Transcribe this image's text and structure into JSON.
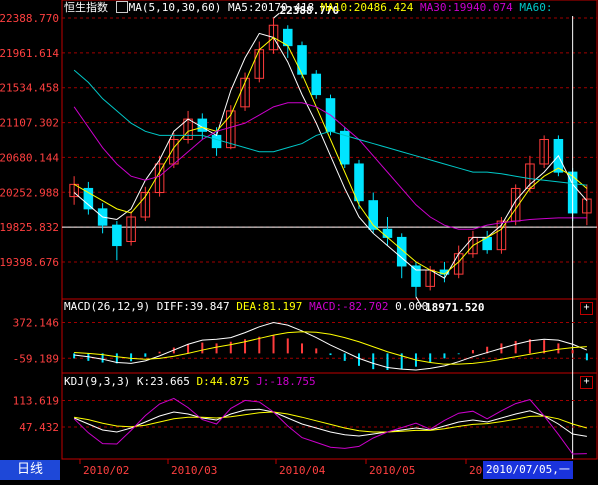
{
  "colors": {
    "up": "#ff3c3c",
    "down": "#00e4ff",
    "ma5": "#ffffff",
    "ma10": "#ffff00",
    "ma30": "#cc00cc",
    "ma60": "#00c8c8",
    "grid": "#a00000",
    "axis_text": "#ff4040",
    "border": "#c00000",
    "tab_bg": "#1e48d8",
    "date_highlight": "#1a33dd"
  },
  "header": {
    "index_name": "恒生指数",
    "ma_icon": "ma-legend-icon",
    "ma_params": "MA(5,10,30,60)",
    "ma5": "MA5:20170.418",
    "ma10": "MA10:20486.424",
    "ma30": "MA30:19940.074",
    "ma60": "MA60:"
  },
  "macd_header": {
    "params": "MACD(26,12,9)",
    "diff": "DIFF:39.847",
    "dea": "DEA:81.197",
    "macd": "MACD:-82.702",
    "zero": "0.000"
  },
  "kdj_header": {
    "params": "KDJ(9,3,3)",
    "k": "K:23.665",
    "d": "D:44.875",
    "j": "J:-18.755"
  },
  "bottom_tab": "日线",
  "cursor_date": "2010/07/05,一",
  "panel_buttons": [
    "+",
    "+"
  ],
  "chart_data": [
    {
      "type": "candlestick",
      "title": "恒生指数",
      "y_ticks": [
        "22388.770",
        "21961.614",
        "21534.458",
        "21107.302",
        "20680.144",
        "20252.988",
        "19825.832",
        "19398.676"
      ],
      "ylim": [
        19060,
        22470
      ],
      "x_ticks": [
        "2010/02",
        "2010/03",
        "2010/04",
        "2010/05",
        "2010/06"
      ],
      "annotations": [
        {
          "text": "22388.770",
          "note": "high"
        },
        {
          "text": "18971.520",
          "note": "low"
        }
      ],
      "series": [
        {
          "name": "MA5",
          "color": "#ffffff",
          "values": [
            20250,
            20100,
            19950,
            19920,
            20050,
            20400,
            20650,
            21000,
            21150,
            21050,
            20950,
            21500,
            21900,
            22200,
            22150,
            21850,
            21450,
            21100,
            20700,
            20300,
            19950,
            19750,
            19600,
            19450,
            19300,
            19300,
            19200,
            19500,
            19700,
            19700,
            19850,
            20150,
            20350,
            20500,
            20700,
            20350,
            20150
          ]
        },
        {
          "name": "MA10",
          "color": "#ffff00",
          "values": [
            20350,
            20250,
            20150,
            20050,
            20000,
            20200,
            20500,
            20800,
            21000,
            21050,
            21000,
            21200,
            21600,
            22000,
            22150,
            22050,
            21700,
            21300,
            20900,
            20500,
            20100,
            19850,
            19700,
            19550,
            19400,
            19300,
            19250,
            19400,
            19600,
            19700,
            19800,
            20050,
            20300,
            20450,
            20550,
            20450,
            20300
          ]
        },
        {
          "name": "MA30",
          "color": "#cc00cc",
          "values": [
            21300,
            21050,
            20800,
            20600,
            20450,
            20400,
            20450,
            20600,
            20750,
            20900,
            21000,
            21050,
            21100,
            21200,
            21300,
            21350,
            21350,
            21300,
            21200,
            21050,
            20900,
            20700,
            20500,
            20300,
            20100,
            19950,
            19850,
            19800,
            19800,
            19850,
            19880,
            19900,
            19920,
            19930,
            19940,
            19940,
            19940
          ]
        },
        {
          "name": "MA60",
          "color": "#00c8c8",
          "values": [
            21750,
            21600,
            21400,
            21250,
            21100,
            21000,
            20950,
            20950,
            20950,
            20950,
            20900,
            20850,
            20800,
            20750,
            20750,
            20800,
            20850,
            20950,
            21000,
            20950,
            20900,
            20850,
            20800,
            20750,
            20700,
            20650,
            20600,
            20550,
            20500,
            20500,
            20480,
            20450,
            20420,
            20400,
            20380,
            20360,
            20340
          ]
        }
      ],
      "candles": [
        [
          20200,
          20350,
          20100,
          20450
        ],
        [
          20300,
          20050,
          19980,
          20380
        ],
        [
          20050,
          19850,
          19750,
          20120
        ],
        [
          19850,
          19600,
          19420,
          19900
        ],
        [
          19650,
          19950,
          19600,
          20020
        ],
        [
          19950,
          20250,
          19900,
          20320
        ],
        [
          20250,
          20600,
          20200,
          20700
        ],
        [
          20600,
          20900,
          20550,
          20980
        ],
        [
          20900,
          21150,
          20850,
          21250
        ],
        [
          21150,
          21000,
          20900,
          21220
        ],
        [
          20950,
          20800,
          20700,
          21050
        ],
        [
          20800,
          21250,
          20780,
          21320
        ],
        [
          21300,
          21650,
          21250,
          21720
        ],
        [
          21650,
          22000,
          21600,
          22100
        ],
        [
          22000,
          22300,
          21950,
          22388
        ],
        [
          22250,
          22050,
          21900,
          22300
        ],
        [
          22050,
          21700,
          21650,
          22100
        ],
        [
          21700,
          21450,
          21400,
          21750
        ],
        [
          21400,
          21000,
          20950,
          21450
        ],
        [
          21000,
          20600,
          20550,
          21050
        ],
        [
          20600,
          20150,
          20050,
          20650
        ],
        [
          20150,
          19800,
          19750,
          20250
        ],
        [
          19800,
          19700,
          19600,
          19950
        ],
        [
          19700,
          19350,
          19200,
          19750
        ],
        [
          19350,
          19100,
          18972,
          19400
        ],
        [
          19100,
          19300,
          19050,
          19350
        ],
        [
          19300,
          19250,
          19150,
          19400
        ],
        [
          19250,
          19500,
          19200,
          19600
        ],
        [
          19500,
          19700,
          19450,
          19780
        ],
        [
          19700,
          19550,
          19500,
          19780
        ],
        [
          19550,
          19900,
          19500,
          19950
        ],
        [
          19900,
          20300,
          19850,
          20350
        ],
        [
          20300,
          20600,
          20250,
          20700
        ],
        [
          20600,
          20900,
          20550,
          20950
        ],
        [
          20900,
          20500,
          20450,
          20950
        ],
        [
          20500,
          20000,
          19900,
          20550
        ],
        [
          20000,
          20170,
          19850,
          20350
        ]
      ]
    },
    {
      "type": "bar",
      "title": "MACD(26,12,9)",
      "y_ticks": [
        "372.146",
        "-59.189"
      ],
      "ylim": [
        -200,
        450
      ],
      "series": [
        {
          "name": "MACD",
          "values": [
            -60,
            -90,
            -110,
            -120,
            -95,
            -40,
            20,
            70,
            110,
            130,
            120,
            140,
            170,
            200,
            220,
            180,
            120,
            60,
            -20,
            -90,
            -150,
            -190,
            -200,
            -190,
            -160,
            -110,
            -60,
            -10,
            40,
            80,
            120,
            150,
            170,
            160,
            120,
            40,
            -83
          ]
        },
        {
          "name": "DIFF",
          "values": [
            -20,
            -40,
            -70,
            -110,
            -120,
            -90,
            -30,
            40,
            110,
            160,
            170,
            190,
            250,
            320,
            372,
            340,
            270,
            190,
            100,
            20,
            -60,
            -120,
            -170,
            -190,
            -200,
            -180,
            -150,
            -100,
            -40,
            10,
            60,
            110,
            150,
            170,
            160,
            110,
            40
          ]
        },
        {
          "name": "DEA",
          "values": [
            10,
            0,
            -15,
            -40,
            -60,
            -70,
            -60,
            -35,
            0,
            40,
            75,
            105,
            140,
            180,
            220,
            250,
            260,
            255,
            230,
            190,
            140,
            80,
            20,
            -30,
            -80,
            -110,
            -130,
            -130,
            -120,
            -100,
            -70,
            -40,
            -10,
            20,
            50,
            70,
            81
          ]
        }
      ]
    },
    {
      "type": "line",
      "title": "KDJ(9,3,3)",
      "y_ticks": [
        "113.619",
        "47.432"
      ],
      "ylim": [
        -25,
        135
      ],
      "series": [
        {
          "name": "K",
          "values": [
            70,
            55,
            40,
            35,
            45,
            60,
            75,
            85,
            80,
            70,
            65,
            80,
            90,
            92,
            85,
            70,
            55,
            45,
            35,
            28,
            25,
            30,
            35,
            40,
            45,
            40,
            50,
            60,
            65,
            60,
            70,
            80,
            88,
            75,
            55,
            30,
            24
          ]
        },
        {
          "name": "D",
          "values": [
            72,
            66,
            57,
            50,
            48,
            52,
            60,
            68,
            72,
            72,
            70,
            73,
            78,
            83,
            85,
            80,
            72,
            63,
            54,
            45,
            38,
            35,
            35,
            37,
            39,
            39,
            43,
            49,
            54,
            56,
            61,
            67,
            74,
            75,
            68,
            55,
            45
          ]
        },
        {
          "name": "J",
          "values": [
            68,
            33,
            6,
            5,
            39,
            76,
            105,
            119,
            96,
            66,
            55,
            94,
            114,
            110,
            85,
            50,
            21,
            9,
            -3,
            -6,
            -1,
            20,
            35,
            46,
            57,
            42,
            64,
            82,
            87,
            68,
            88,
            106,
            116,
            75,
            29,
            -20,
            -19
          ]
        }
      ]
    }
  ]
}
